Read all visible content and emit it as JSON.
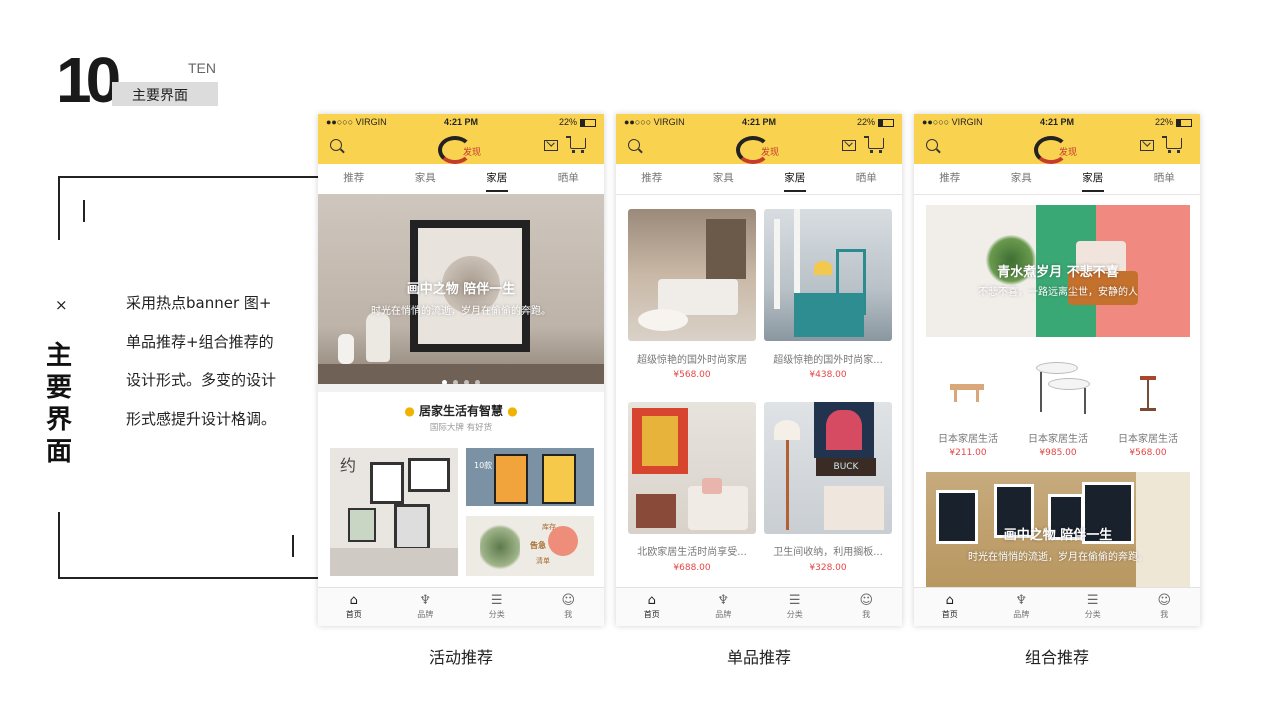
{
  "header": {
    "number": "10",
    "ten": "TEN",
    "title": "主要界面"
  },
  "left_panel": {
    "x_mark": "×",
    "vertical_title": "主要界面",
    "description": "采用热点banner 图+ 单品推荐+组合推荐的设计形式。多变的设计形式感提升设计格调。"
  },
  "status_bar": {
    "carrier": "●●○○○ VIRGIN",
    "time": "4:21 PM",
    "battery": "22%"
  },
  "app": {
    "logo_text": "发现"
  },
  "tabs": [
    "推荐",
    "家具",
    "家居",
    "晒单"
  ],
  "bottom_nav": [
    {
      "label": "首页",
      "icon": "home-icon"
    },
    {
      "label": "品牌",
      "icon": "brand-icon"
    },
    {
      "label": "分类",
      "icon": "category-icon"
    },
    {
      "label": "我",
      "icon": "user-icon"
    }
  ],
  "screen1": {
    "banner_title": "画中之物  陪伴一生",
    "banner_sub": "时光在悄悄的流逝，岁月在偷偷的奔跑。",
    "section_title": "居家生活有智慧",
    "section_sub": "国际大牌 有好货",
    "card_text": "约",
    "card_num": "10款",
    "card_store": "库存",
    "card_notice": "告急",
    "card_clear": "清单"
  },
  "screen2": {
    "products": [
      {
        "name": "超级惊艳的国外时尚家居",
        "price": "¥568.00"
      },
      {
        "name": "超级惊艳的国外时尚家...",
        "price": "¥438.00"
      },
      {
        "name": "北欧家居生活时尚享受...",
        "price": "¥688.00"
      },
      {
        "name": "卫生间收纳，利用搁板...",
        "price": "¥328.00"
      }
    ],
    "buck_text": "BUCK"
  },
  "screen3": {
    "banner_title": "青水煮岁月  不悲不喜",
    "banner_sub": "不悲不喜，一路远离尘世，安静的人",
    "products": [
      {
        "name": "日本家居生活",
        "price": "¥211.00"
      },
      {
        "name": "日本家居生活",
        "price": "¥985.00"
      },
      {
        "name": "日本家居生活",
        "price": "¥568.00"
      }
    ],
    "banner2_title": "画中之物  陪伴一生",
    "banner2_sub": "时光在悄悄的流逝，岁月在偷偷的奔跑。"
  },
  "captions": [
    "活动推荐",
    "单品推荐",
    "组合推荐"
  ],
  "colors": {
    "accent": "#f9d24f",
    "price": "#e64545"
  }
}
